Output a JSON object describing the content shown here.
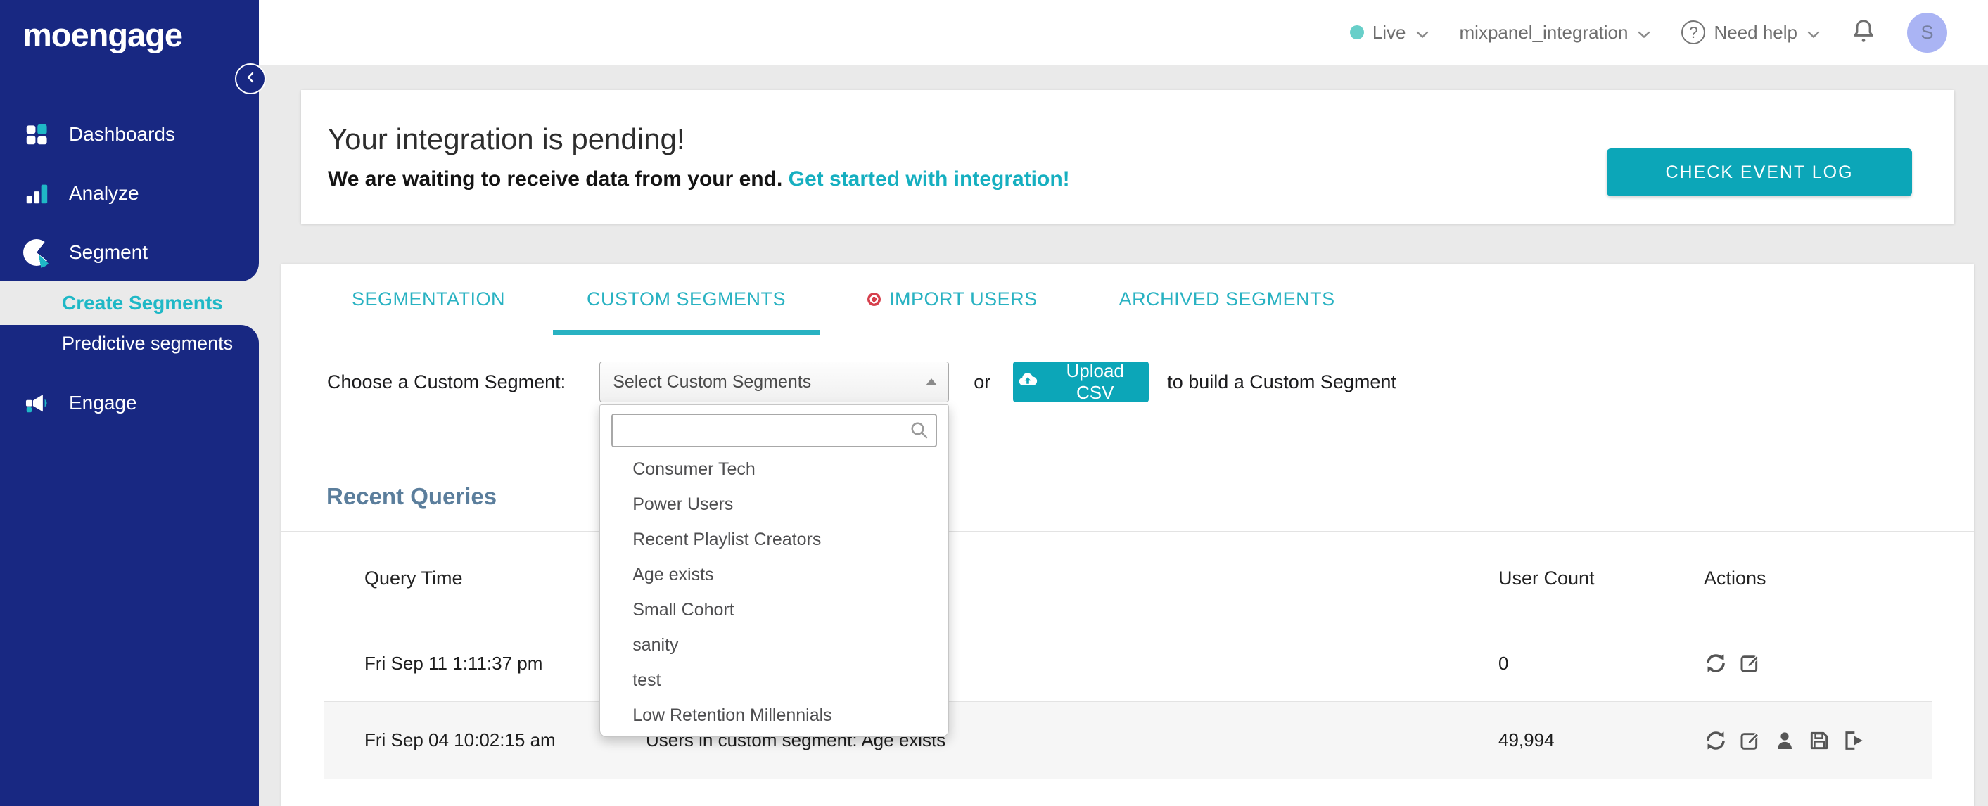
{
  "colors": {
    "sidebar_navy": "#182882",
    "accent_teal": "#0ca6b8",
    "tab_teal": "#29b2c2",
    "active_item_teal": "#1fb8c6",
    "link_teal": "#16afc0",
    "live_dot_teal": "#68cfc9",
    "import_dot_red": "#d6404d",
    "heading_slate": "#5b7e9c",
    "avatar_bg": "#aab4f4",
    "page_bg": "#eaeaea",
    "row_stripe": "#f6f6f6"
  },
  "sidebar": {
    "logo": "moengage",
    "items": [
      {
        "label": "Dashboards",
        "icon": "dashboards-icon"
      },
      {
        "label": "Analyze",
        "icon": "analyze-icon"
      },
      {
        "label": "Segment",
        "icon": "segment-icon"
      }
    ],
    "sub_items": [
      {
        "label": "Create Segments",
        "active": true
      },
      {
        "label": "Predictive segments",
        "active": false
      }
    ],
    "items_bottom": [
      {
        "label": "Engage",
        "icon": "engage-icon"
      }
    ]
  },
  "header": {
    "environment": "Live",
    "project": "mixpanel_integration",
    "help_label": "Need help",
    "avatar_initial": "S"
  },
  "banner": {
    "title": "Your integration is pending!",
    "subtitle": "We are waiting to receive data from your end.",
    "link_label": "Get started with integration!",
    "button_label": "CHECK EVENT LOG"
  },
  "tabs": [
    {
      "label": "SEGMENTATION",
      "active": false
    },
    {
      "label": "CUSTOM SEGMENTS",
      "active": true
    },
    {
      "label": "IMPORT USERS",
      "active": false,
      "dot": true
    },
    {
      "label": "ARCHIVED SEGMENTS",
      "active": false
    }
  ],
  "segment_picker": {
    "label": "Choose a Custom Segment:",
    "select_value": "Select Custom Segments",
    "or_text": "or",
    "upload_button_label": "Upload CSV",
    "suffix_text": "to build a Custom Segment",
    "search_value": "",
    "options": [
      "Consumer Tech",
      "Power Users",
      "Recent Playlist Creators",
      "Age exists",
      "Small Cohort",
      "sanity",
      "test",
      "Low Retention Millennials"
    ]
  },
  "recent_queries": {
    "title": "Recent Queries",
    "columns": {
      "time": "Query Time",
      "user_count": "User Count",
      "actions": "Actions"
    },
    "rows": [
      {
        "time": "Fri Sep 11 1:11:37 pm",
        "description": "",
        "user_count": "0",
        "actions": [
          "refresh",
          "edit"
        ]
      },
      {
        "time": "Fri Sep 04 10:02:15 am",
        "description": "Users in custom segment: Age exists",
        "user_count": "49,994",
        "actions": [
          "refresh",
          "edit",
          "user",
          "save",
          "export"
        ]
      }
    ]
  }
}
